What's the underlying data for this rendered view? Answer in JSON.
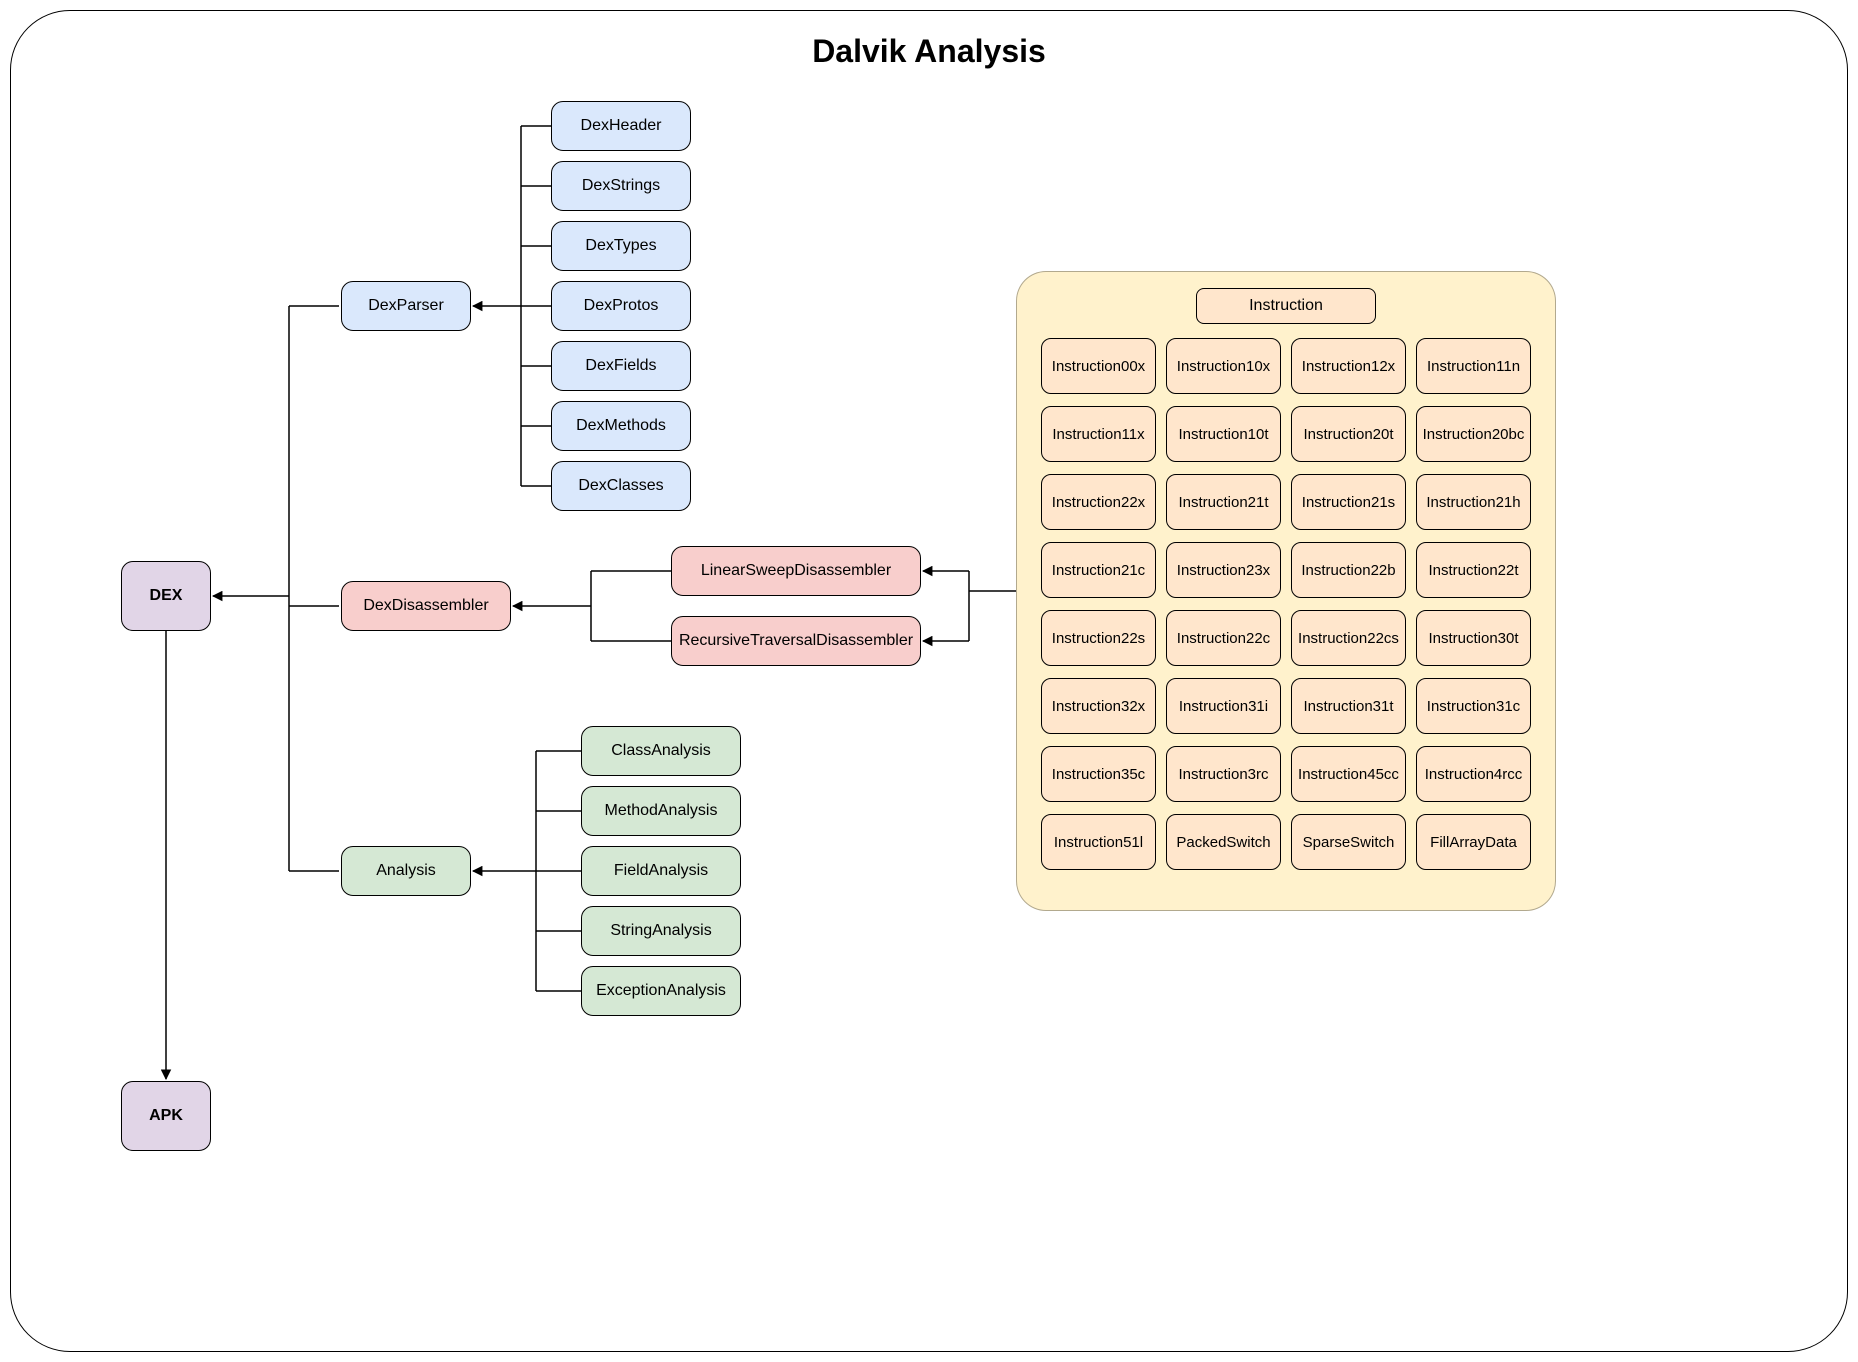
{
  "title": "Dalvik Analysis",
  "root": {
    "dex": "DEX",
    "apk": "APK"
  },
  "dexparser": {
    "label": "DexParser",
    "children": [
      "DexHeader",
      "DexStrings",
      "DexTypes",
      "DexProtos",
      "DexFields",
      "DexMethods",
      "DexClasses"
    ]
  },
  "dexdisassembler": {
    "label": "DexDisassembler",
    "children": [
      "LinearSweepDisassembler",
      "RecursiveTraversalDisassembler"
    ]
  },
  "analysis": {
    "label": "Analysis",
    "children": [
      "ClassAnalysis",
      "MethodAnalysis",
      "FieldAnalysis",
      "StringAnalysis",
      "ExceptionAnalysis"
    ]
  },
  "instruction": {
    "header": "Instruction",
    "cells": [
      "Instruction00x",
      "Instruction10x",
      "Instruction12x",
      "Instruction11n",
      "Instruction11x",
      "Instruction10t",
      "Instruction20t",
      "Instruction20bc",
      "Instruction22x",
      "Instruction21t",
      "Instruction21s",
      "Instruction21h",
      "Instruction21c",
      "Instruction23x",
      "Instruction22b",
      "Instruction22t",
      "Instruction22s",
      "Instruction22c",
      "Instruction22cs",
      "Instruction30t",
      "Instruction32x",
      "Instruction31i",
      "Instruction31t",
      "Instruction31c",
      "Instruction35c",
      "Instruction3rc",
      "Instruction45cc",
      "Instruction4rcc",
      "Instruction51l",
      "PackedSwitch",
      "SparseSwitch",
      "FillArrayData"
    ]
  },
  "chart_data": {
    "type": "table",
    "title": "Dalvik Analysis",
    "nodes": [
      {
        "id": "DEX",
        "children": [
          "DexParser",
          "DexDisassembler",
          "Analysis",
          "APK"
        ]
      },
      {
        "id": "APK"
      },
      {
        "id": "DexParser",
        "children": [
          "DexHeader",
          "DexStrings",
          "DexTypes",
          "DexProtos",
          "DexFields",
          "DexMethods",
          "DexClasses"
        ]
      },
      {
        "id": "DexDisassembler",
        "children": [
          "LinearSweepDisassembler",
          "RecursiveTraversalDisassembler"
        ]
      },
      {
        "id": "InstructionGroup",
        "label": "Instruction",
        "children": [
          "LinearSweepDisassembler",
          "RecursiveTraversalDisassembler"
        ],
        "members": [
          "Instruction00x",
          "Instruction10x",
          "Instruction12x",
          "Instruction11n",
          "Instruction11x",
          "Instruction10t",
          "Instruction20t",
          "Instruction20bc",
          "Instruction22x",
          "Instruction21t",
          "Instruction21s",
          "Instruction21h",
          "Instruction21c",
          "Instruction23x",
          "Instruction22b",
          "Instruction22t",
          "Instruction22s",
          "Instruction22c",
          "Instruction22cs",
          "Instruction30t",
          "Instruction32x",
          "Instruction31i",
          "Instruction31t",
          "Instruction31c",
          "Instruction35c",
          "Instruction3rc",
          "Instruction45cc",
          "Instruction4rcc",
          "Instruction51l",
          "PackedSwitch",
          "SparseSwitch",
          "FillArrayData"
        ]
      },
      {
        "id": "Analysis",
        "children": [
          "ClassAnalysis",
          "MethodAnalysis",
          "FieldAnalysis",
          "StringAnalysis",
          "ExceptionAnalysis"
        ]
      }
    ]
  }
}
